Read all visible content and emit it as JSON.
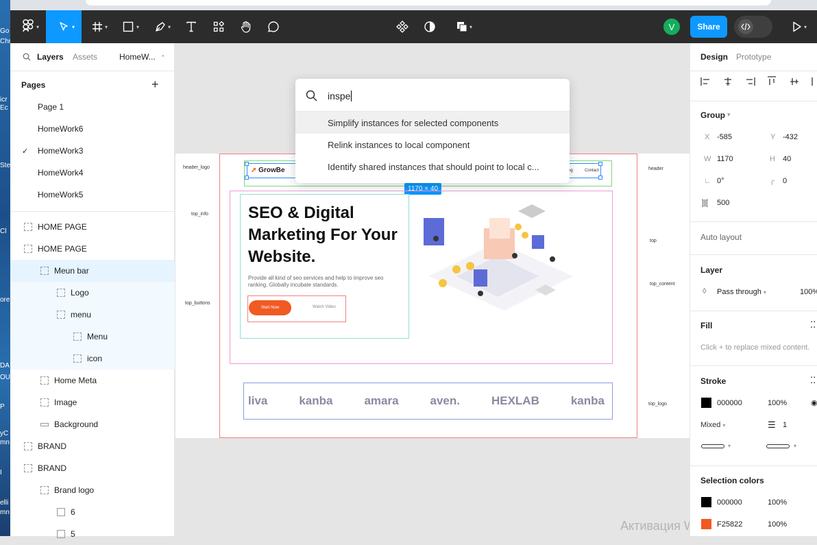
{
  "desktop": {
    "labels": [
      "Go",
      "Chr",
      "icr",
      "Ec",
      "Ste",
      "Cl",
      "ore",
      "DA",
      "OUL",
      "P",
      "yC",
      "mn",
      "I",
      "elli",
      "mn"
    ]
  },
  "toolbar": {
    "avatar_letter": "V",
    "share_label": "Share",
    "colors": {
      "bg": "#2c2c2c",
      "active": "#0d99ff",
      "avatar": "#14ae5c"
    }
  },
  "left_panel": {
    "tabs": {
      "layers": "Layers",
      "assets": "Assets",
      "page_select": "HomeW..."
    },
    "pages_heading": "Pages",
    "pages": [
      "Page 1",
      "HomeWork6",
      "HomeWork3",
      "HomeWork4",
      "HomeWork5"
    ],
    "current_page": "HomeWork3",
    "layers": [
      {
        "label": "HOME PAGE",
        "depth": 0
      },
      {
        "label": "HOME PAGE",
        "depth": 0
      },
      {
        "label": "Meun bar",
        "depth": 1,
        "selected": true
      },
      {
        "label": "Logo",
        "depth": 2
      },
      {
        "label": "menu",
        "depth": 2
      },
      {
        "label": "Menu",
        "depth": 3
      },
      {
        "label": "icon",
        "depth": 3
      },
      {
        "label": "Home Meta",
        "depth": 1
      },
      {
        "label": "Image",
        "depth": 1
      },
      {
        "label": "Background",
        "depth": 1
      },
      {
        "label": "BRAND",
        "depth": 0
      },
      {
        "label": "BRAND",
        "depth": 0
      },
      {
        "label": "Brand logo",
        "depth": 1
      },
      {
        "label": "6",
        "depth": 2
      },
      {
        "label": "5",
        "depth": 2
      }
    ]
  },
  "command_palette": {
    "query": "inspe",
    "options": [
      "Simplify instances for selected components",
      "Relink instances to local component",
      "Identify shared instances that should point to local c..."
    ]
  },
  "canvas": {
    "frame_labels": {
      "header_logo": "header_logo",
      "top_info": "top_info",
      "top_buttons": "top_buttons",
      "header": "header",
      "top": "top",
      "top_content": "top_content",
      "top_logo": "top_logo"
    },
    "size_badge": "1170 × 40",
    "site": {
      "logo": "GrowBe",
      "nav_partial": "og",
      "nav_contact": "Contact",
      "headline": "SEO & Digital Marketing For Your Website.",
      "subtext": "Provide all kind of seo services and help to improve seo ranking. Globally incubate standards.",
      "btn_primary": "Start Now",
      "btn_secondary": "Watch Video",
      "brands": [
        "liva",
        "kanba",
        "amara",
        "aven.",
        "HEXLAB",
        "kanba"
      ],
      "accent": "#f15a22"
    }
  },
  "right_panel": {
    "tabs": {
      "design": "Design",
      "prototype": "Prototype"
    },
    "group_title": "Group",
    "x_label": "X",
    "x_value": "-585",
    "y_label": "Y",
    "y_value": "-432",
    "w_label": "W",
    "w_value": "1170",
    "h_label": "H",
    "h_value": "40",
    "rotation": "0°",
    "radius": "0",
    "spacing": "500",
    "auto_layout": "Auto layout",
    "layer_title": "Layer",
    "blend_mode": "Pass through",
    "opacity": "100%",
    "fill_title": "Fill",
    "fill_hint": "Click + to replace mixed content.",
    "stroke_title": "Stroke",
    "stroke_color": "000000",
    "stroke_opacity": "100%",
    "stroke_mixed": "Mixed",
    "stroke_weight": "1",
    "selection_colors_title": "Selection colors",
    "selection_colors": [
      {
        "hex": "000000",
        "opacity": "100%",
        "swatch": "#000000"
      },
      {
        "hex": "F25822",
        "opacity": "100%",
        "swatch": "#f25822"
      }
    ]
  },
  "watermark": "Активация Windows"
}
